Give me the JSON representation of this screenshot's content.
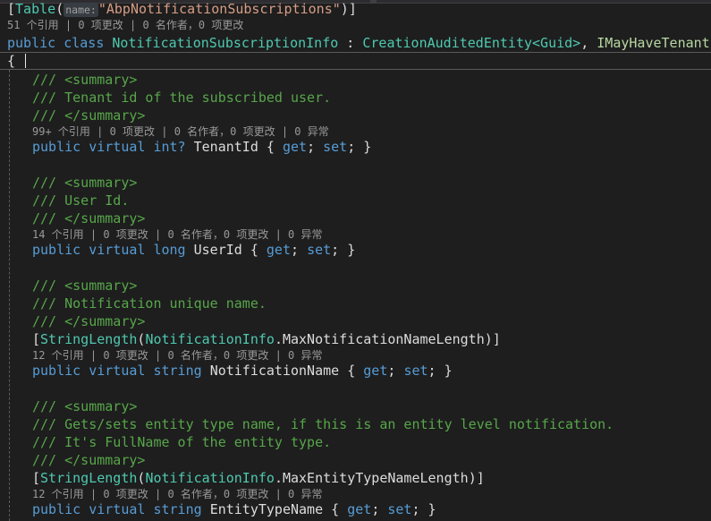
{
  "editor": {
    "theme_name": "visual-studio-dark",
    "colors": {
      "background": "#1e1e1e",
      "keyword": "#569cd6",
      "type": "#4ec9b0",
      "interface": "#b8d7a3",
      "string": "#d69d85",
      "comment": "#57a64a",
      "identifier": "#dcdcdc",
      "codelens": "#999999",
      "current_line_border": "#5a5a5a"
    }
  },
  "code": {
    "attribute_table": {
      "open_bracket": "[",
      "name": "Table",
      "paren_open": "(",
      "param_hint": "name:",
      "string_value": "\"AbpNotificationSubscriptions\"",
      "paren_close": ")",
      "close_bracket": "]"
    },
    "class_codelens": "51 个引用 | 0 项更改 | 0 名作者，0 项更改",
    "class_decl": {
      "modifier": "public",
      "keyword": "class",
      "name": "NotificationSubscriptionInfo",
      "colon": " : ",
      "base_type": "CreationAuditedEntity<Guid>",
      "comma": ", ",
      "interface": "IMayHaveTenant"
    },
    "open_brace": "{",
    "members": [
      {
        "doc": [
          "/// <summary>",
          "/// Tenant id of the subscribed user.",
          "/// </summary>"
        ],
        "attribute": null,
        "codelens": "99+ 个引用 | 0 项更改 | 0 名作者，0 项更改 | 0 异常",
        "signature": {
          "modifier": "public",
          "virtual": "virtual",
          "type": "int?",
          "type_kind": "keyword",
          "name": "TenantId",
          "accessors": "{ get; set; }"
        }
      },
      {
        "doc": [
          "/// <summary>",
          "/// User Id.",
          "/// </summary>"
        ],
        "attribute": null,
        "codelens": "14 个引用 | 0 项更改 | 0 名作者，0 项更改 | 0 异常",
        "signature": {
          "modifier": "public",
          "virtual": "virtual",
          "type": "long",
          "type_kind": "keyword",
          "name": "UserId",
          "accessors": "{ get; set; }"
        }
      },
      {
        "doc": [
          "/// <summary>",
          "/// Notification unique name.",
          "/// </summary>"
        ],
        "attribute": {
          "name": "StringLength",
          "arg_type": "NotificationInfo",
          "arg_member": ".MaxNotificationNameLength"
        },
        "codelens": "12 个引用 | 0 项更改 | 0 名作者，0 项更改 | 0 异常",
        "signature": {
          "modifier": "public",
          "virtual": "virtual",
          "type": "string",
          "type_kind": "keyword",
          "name": "NotificationName",
          "accessors": "{ get; set; }"
        }
      },
      {
        "doc": [
          "/// <summary>",
          "/// Gets/sets entity type name, if this is an entity level notification.",
          "/// It's FullName of the entity type.",
          "/// </summary>"
        ],
        "attribute": {
          "name": "StringLength",
          "arg_type": "NotificationInfo",
          "arg_member": ".MaxEntityTypeNameLength"
        },
        "codelens": "12 个引用 | 0 项更改 | 0 名作者，0 项更改 | 0 异常",
        "signature": {
          "modifier": "public",
          "virtual": "virtual",
          "type": "string",
          "type_kind": "keyword",
          "name": "EntityTypeName",
          "accessors": "{ get; set; }"
        }
      }
    ]
  }
}
